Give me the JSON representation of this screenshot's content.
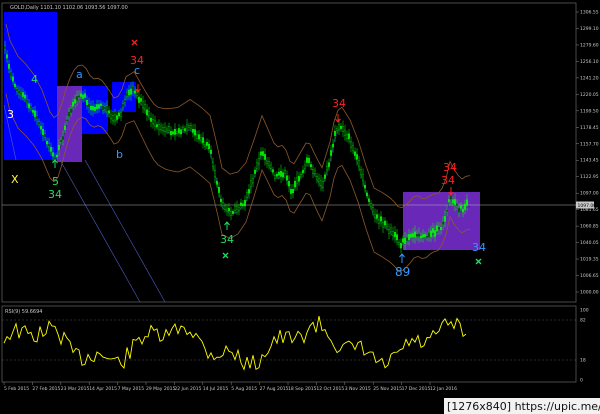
{
  "symbol_header": "GOLD,Daily  1101.10 1102.06 1093.56 1097.00",
  "rsi_header": "RSI(9) 59.6694",
  "price_axis": [
    "1306.55",
    "1299.10",
    "1279.60",
    "1256.10",
    "1241.20",
    "1220.05",
    "1199.50",
    "1178.45",
    "1157.70",
    "1143.45",
    "1122.95",
    "1097.00",
    "1081.65",
    "1060.85",
    "1040.05",
    "1019.35",
    "1006.65",
    "1000.00"
  ],
  "current_price": "1097.00",
  "rsi_axis": [
    "100",
    "82",
    "18",
    "0"
  ],
  "date_axis": [
    "5 Feb 2015",
    "27 Feb 2015",
    "23 Mar 2015",
    "14 Apr 2015",
    "7 May 2015",
    "29 May 2015",
    "22 Jun 2015",
    "14 Jul 2015",
    "5 Aug 2015",
    "27 Aug 2015",
    "18 Sep 2015",
    "12 Oct 2015",
    "3 Nov 2015",
    "25 Nov 2015",
    "17 Dec 2015",
    "12 Jan 2016"
  ],
  "wave_labels": {
    "w4": "4",
    "w3": "3",
    "wX": "X",
    "w5": "5",
    "wa": "a",
    "wb": "b",
    "wc": "c",
    "c34_1": "34",
    "c34_2": "34",
    "c34_3": "34",
    "c34_4": "34",
    "c34_5": "34",
    "c34_6": "34",
    "c34_7": "34",
    "c89": "89"
  },
  "watermark": "[1276x840] https://upic.me/",
  "colors": {
    "background": "#000000",
    "bull_candle": "#00ff00",
    "box_blue": "#0000ff",
    "box_purple": "#6a28b8",
    "band": "#8b5a2b",
    "rsi_line": "#ffff00",
    "label_red": "#ff2020",
    "label_green": "#22dd66",
    "label_blue": "#3399ff"
  }
}
